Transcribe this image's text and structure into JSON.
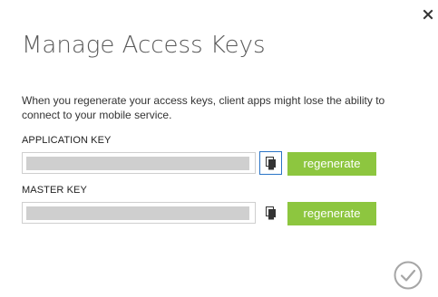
{
  "dialog": {
    "title": "Manage Access Keys",
    "description": "When you regenerate your access keys, client apps might lose the ability to connect to your mobile service.",
    "close_icon": "close-icon",
    "confirm_icon": "checkmark-circle-icon"
  },
  "application_key": {
    "label": "APPLICATION KEY",
    "value": "",
    "copy_icon": "copy-icon",
    "regenerate_label": "regenerate"
  },
  "master_key": {
    "label": "MASTER KEY",
    "value": "",
    "copy_icon": "copy-icon",
    "regenerate_label": "regenerate"
  },
  "colors": {
    "accent_green": "#8dc63f",
    "focus_blue": "#2a74c6",
    "title_gray": "#5a5a5a"
  }
}
